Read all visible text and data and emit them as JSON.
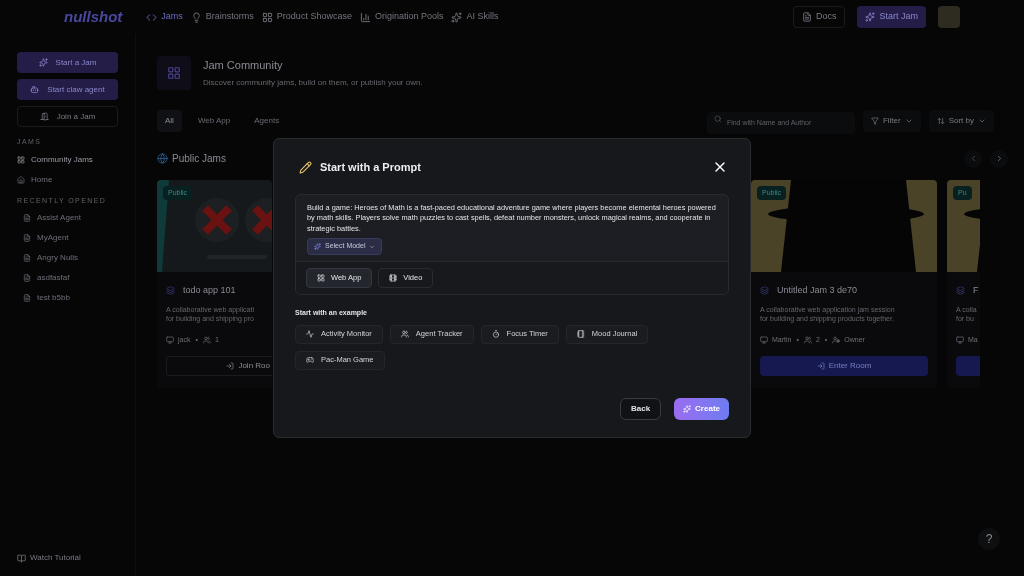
{
  "header": {
    "logo": "nullshot",
    "nav": [
      {
        "label": "Jams",
        "selected": true
      },
      {
        "label": "Brainstorms",
        "selected": false
      },
      {
        "label": "Product Showcase",
        "selected": false
      },
      {
        "label": "Origination Pools",
        "selected": false
      },
      {
        "label": "AI Skills",
        "selected": false
      }
    ],
    "docs": "Docs",
    "start_jam": "Start Jam"
  },
  "sidebar": {
    "actions": [
      {
        "label": "Start a Jam",
        "kind": "primary"
      },
      {
        "label": "Start claw agent",
        "kind": "primary"
      },
      {
        "label": "Join a Jam",
        "kind": "outline"
      }
    ],
    "sections": [
      {
        "title": "JAMS",
        "items": [
          {
            "label": "Community Jams",
            "selected": true
          },
          {
            "label": "Home",
            "selected": false
          }
        ]
      },
      {
        "title": "RECENTLY OPENED",
        "items": [
          {
            "label": "Assist Agent",
            "selected": false
          },
          {
            "label": "MyAgent",
            "selected": false
          },
          {
            "label": "Angry Nulls",
            "selected": false
          },
          {
            "label": "asdfasfaf",
            "selected": false
          },
          {
            "label": "test b5bb",
            "selected": false
          }
        ]
      }
    ],
    "footer": "Watch Tutorial"
  },
  "page": {
    "title": "Jam Community",
    "subtitle": "Discover community jams, build on them, or publish your own.",
    "tabs": [
      {
        "label": "All",
        "selected": true
      },
      {
        "label": "Web App",
        "selected": false
      },
      {
        "label": "Agents",
        "selected": false
      }
    ],
    "search": {
      "placeholder": "Find with Name and Author"
    },
    "filter": "Filter",
    "sort": "Sort by",
    "section_title": "Public Jams"
  },
  "cards": [
    {
      "badge": "Public",
      "title": "todo app 101",
      "description": [
        "A collaborative web applicati",
        "for building and shipping pro"
      ],
      "meta": [
        {
          "kind": "author",
          "text": "jack"
        },
        {
          "kind": "separator",
          "text": "•"
        },
        {
          "kind": "members",
          "text": "1"
        }
      ],
      "button": "Join Roo",
      "kind": "join"
    },
    {
      "badge": "Public",
      "title": "Untitled Jam 3 de70",
      "description": [
        "A collaborative web application jam session",
        "for building and shipping products together."
      ],
      "meta": [
        {
          "kind": "author",
          "text": "Martin"
        },
        {
          "kind": "separator",
          "text": "•"
        },
        {
          "kind": "members",
          "text": "2"
        },
        {
          "kind": "separator",
          "text": "•"
        },
        {
          "kind": "role",
          "text": "Owner"
        }
      ],
      "button": "Enter Room",
      "kind": "enter"
    },
    {
      "badge": "Pu",
      "title": "F",
      "description": [
        "A colla",
        "for bu"
      ],
      "meta": [
        {
          "kind": "author",
          "text": "Ma"
        }
      ],
      "kind": "enter"
    }
  ],
  "dialog": {
    "title": "Start with a Prompt",
    "prompt": "Build a game: Heroes of Math is a fast-paced educational adventure game where players become elemental heroes powered by math skills. Players solve math puzzles to cast spells, defeat number monsters, unlock magical realms, and cooperate in strategic battles.",
    "model": "Select Model",
    "types": [
      {
        "label": "Web App",
        "selected": true
      },
      {
        "label": "Video",
        "selected": false
      }
    ],
    "examples_title": "Start with an example",
    "examples": [
      "Activity Monitor",
      "Agent Tracker",
      "Focus Timer",
      "Mood Journal",
      "Pac-Man Game"
    ],
    "back": "Back",
    "create": "Create"
  },
  "help": "?"
}
